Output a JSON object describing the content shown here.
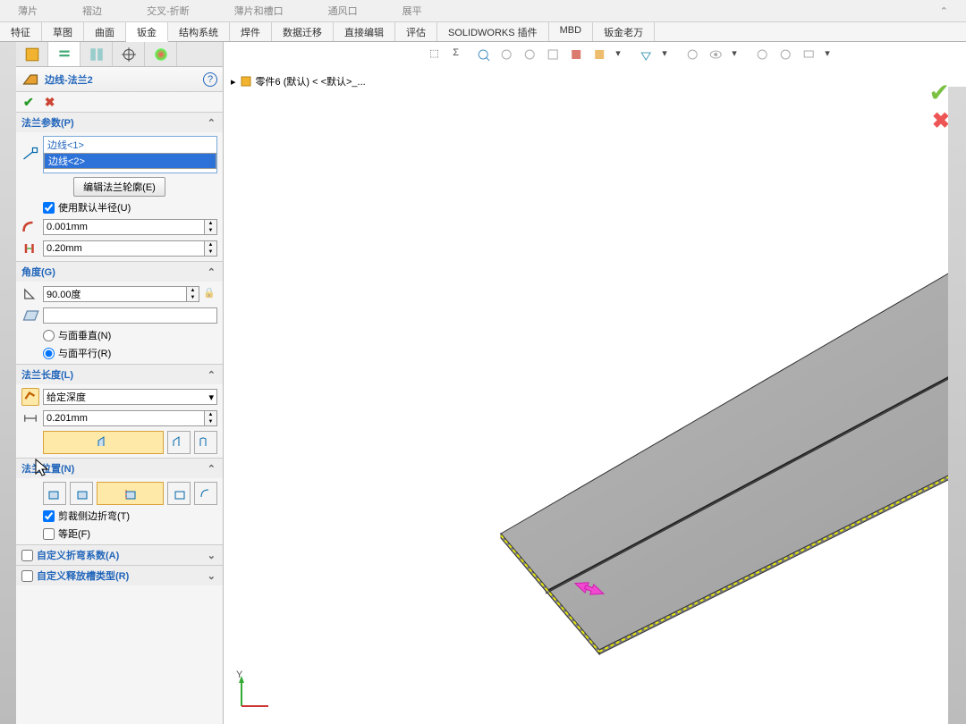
{
  "ribbon_stubs": [
    "薄片",
    "褶边",
    "交叉-折断",
    "薄片和槽口",
    "通风口",
    "展平"
  ],
  "tabs": [
    "特征",
    "草图",
    "曲面",
    "钣金",
    "结构系统",
    "焊件",
    "数据迁移",
    "直接编辑",
    "评估",
    "SOLIDWORKS 插件",
    "MBD",
    "钣金老万"
  ],
  "active_tab": "钣金",
  "feature_title": "边线-法兰2",
  "breadcrumb": "零件6 (默认) < <默认>_...",
  "sections": {
    "flange_params": {
      "title": "法兰参数(P)",
      "edges": [
        "边线<1>",
        "边线<2>"
      ],
      "edit_btn": "编辑法兰轮廓(E)",
      "use_default_radius": "使用默认半径(U)",
      "radius": "0.001mm",
      "gap": "0.20mm"
    },
    "angle": {
      "title": "角度(G)",
      "value": "90.00度",
      "opt1": "与面垂直(N)",
      "opt2": "与面平行(R)"
    },
    "length": {
      "title": "法兰长度(L)",
      "type": "给定深度",
      "value": "0.201mm"
    },
    "position": {
      "title": "法兰位置(N)",
      "trim": "剪裁侧边折弯(T)",
      "offset": "等距(F)"
    },
    "custom_bend": {
      "title": "自定义折弯系数(A)"
    },
    "custom_relief": {
      "title": "自定义释放槽类型(R)"
    }
  },
  "coord_labels": {
    "y": "Y"
  }
}
